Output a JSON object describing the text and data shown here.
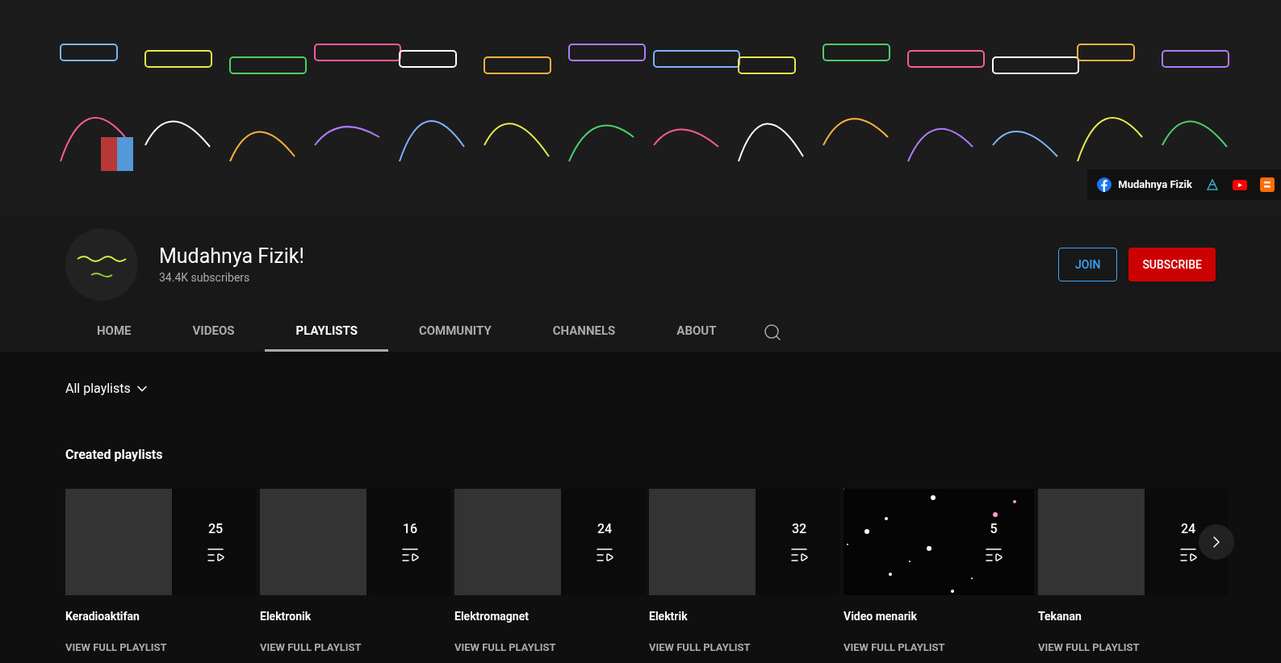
{
  "banner": {
    "kind": "picture",
    "links": [
      {
        "label": "Mudahnya Fizik",
        "kind": "facebook"
      },
      {
        "kind": "crystal"
      },
      {
        "kind": "youtube"
      },
      {
        "kind": "blogger"
      }
    ]
  },
  "channel": {
    "name": "Mudahnya Fizik!",
    "subscribers": "34.4K subscribers",
    "buttons": [
      {
        "label": "JOIN",
        "kind": "outline"
      },
      {
        "label": "SUBSCRIBE",
        "kind": "filled"
      }
    ]
  },
  "tabs": [
    {
      "label": "HOME",
      "selected": false
    },
    {
      "label": "VIDEOS",
      "selected": false
    },
    {
      "label": "PLAYLISTS",
      "selected": true
    },
    {
      "label": "COMMUNITY",
      "selected": false
    },
    {
      "label": "CHANNELS",
      "selected": false
    },
    {
      "label": "ABOUT",
      "selected": false
    }
  ],
  "filter": {
    "label": "All playlists"
  },
  "section": {
    "title": "Created playlists"
  },
  "playlists": [
    {
      "title": "Keradioaktifan",
      "count": "25",
      "link": "VIEW FULL PLAYLIST"
    },
    {
      "title": "Elektronik",
      "count": "16",
      "link": "VIEW FULL PLAYLIST"
    },
    {
      "title": "Elektromagnet",
      "count": "24",
      "link": "VIEW FULL PLAYLIST"
    },
    {
      "title": "Elektrik",
      "count": "32",
      "link": "VIEW FULL PLAYLIST"
    },
    {
      "title": "Video menarik",
      "count": "5",
      "link": "VIEW FULL PLAYLIST"
    },
    {
      "title": "Tekanan",
      "count": "24",
      "link": "VIEW FULL PLAYLIST"
    }
  ]
}
